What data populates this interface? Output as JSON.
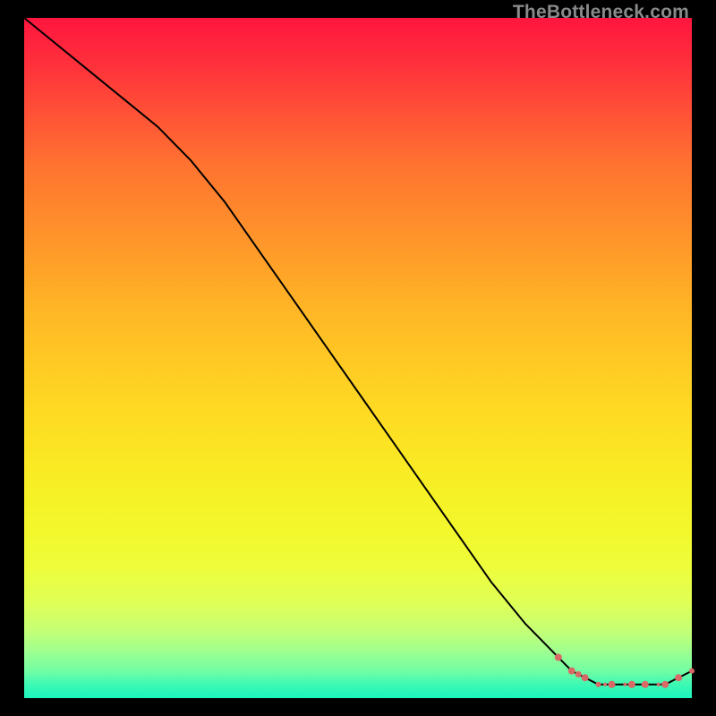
{
  "watermark": "TheBottleneck.com",
  "colors": {
    "curve": "#000000",
    "dots": "#d96966",
    "frame": "#000000"
  },
  "chart_data": {
    "type": "line",
    "title": "",
    "xlabel": "",
    "ylabel": "",
    "xlim": [
      0,
      100
    ],
    "ylim": [
      0,
      100
    ],
    "series": [
      {
        "name": "bottleneck-curve",
        "x": [
          0,
          5,
          10,
          15,
          20,
          25,
          30,
          35,
          40,
          45,
          50,
          55,
          60,
          65,
          70,
          75,
          80,
          82,
          84,
          86,
          88,
          90,
          92,
          94,
          96,
          98,
          100
        ],
        "y": [
          100,
          96,
          92,
          88,
          84,
          79,
          73,
          66,
          59,
          52,
          45,
          38,
          31,
          24,
          17,
          11,
          6,
          4,
          3,
          2,
          2,
          2,
          2,
          2,
          2,
          3,
          4
        ]
      }
    ],
    "optimal_range": {
      "comment": "coral dotted markers where curve is near its minimum",
      "x": [
        80,
        82,
        83,
        84,
        86,
        87,
        88,
        90,
        91,
        93,
        95,
        96,
        98,
        100
      ],
      "y": [
        6,
        4,
        3.5,
        3,
        2,
        2,
        2,
        2,
        2,
        2,
        2,
        2,
        3,
        4
      ],
      "r": [
        4,
        4,
        3.5,
        4,
        3,
        2,
        4,
        2,
        4,
        4,
        2,
        4,
        4,
        3
      ]
    }
  }
}
